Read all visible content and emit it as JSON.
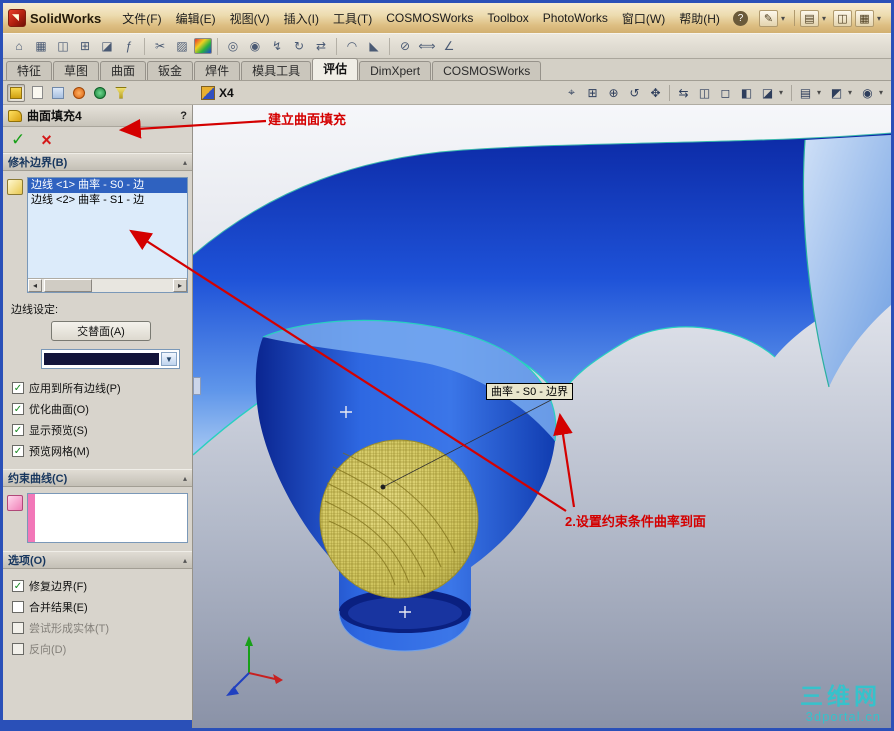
{
  "titlebar": {
    "app_title": "SolidWorks"
  },
  "menubar": {
    "items": [
      "文件(F)",
      "编辑(E)",
      "视图(V)",
      "插入(I)",
      "工具(T)",
      "COSMOSWorks",
      "Toolbox",
      "PhotoWorks",
      "窗口(W)",
      "帮助(H)"
    ]
  },
  "command_tabs": {
    "items": [
      "特征",
      "草图",
      "曲面",
      "钣金",
      "焊件",
      "模具工具",
      "评估",
      "DimXpert",
      "COSMOSWorks"
    ],
    "active": "评估"
  },
  "context": {
    "config_label": "X4"
  },
  "pm": {
    "title": "曲面填充4",
    "help_glyph": "?",
    "boundary": {
      "header": "修补边界(B)",
      "items": [
        "边线 <1> 曲率 - S0 - 边",
        "边线 <2> 曲率 - S1 - 边"
      ],
      "selected_index": 0,
      "edge_setting_label": "边线设定:",
      "alternate_face_button": "交替面(A)",
      "checkboxes": [
        {
          "label": "应用到所有边线(P)",
          "checked": true
        },
        {
          "label": "优化曲面(O)",
          "checked": true
        },
        {
          "label": "显示预览(S)",
          "checked": true
        },
        {
          "label": "预览网格(M)",
          "checked": true
        }
      ]
    },
    "constraint": {
      "header": "约束曲线(C)"
    },
    "options": {
      "header": "选项(O)",
      "checkboxes": [
        {
          "label": "修复边界(F)",
          "checked": true
        },
        {
          "label": "合并结果(E)",
          "checked": false
        },
        {
          "label": "尝试形成实体(T)",
          "checked": false,
          "disabled": true
        },
        {
          "label": "反向(D)",
          "checked": false,
          "disabled": true
        }
      ]
    }
  },
  "viewport": {
    "tooltip": "曲率 - S0 - 边界",
    "watermark": {
      "line1": "三维网",
      "line2": "3dportal.cn"
    }
  },
  "annotations": {
    "note1": "建立曲面填充",
    "note2": "2.设置约束条件曲率到面",
    "color": "#d40000"
  },
  "colors": {
    "selection_blue": "#2f62c0",
    "surface_blue": "#1e52d8",
    "mesh_yellow": "#cfc45e",
    "edge_highlight_teal": "#28d0c0",
    "watermark_cyan": "#2cc4cc",
    "annotation_red": "#d40000"
  }
}
